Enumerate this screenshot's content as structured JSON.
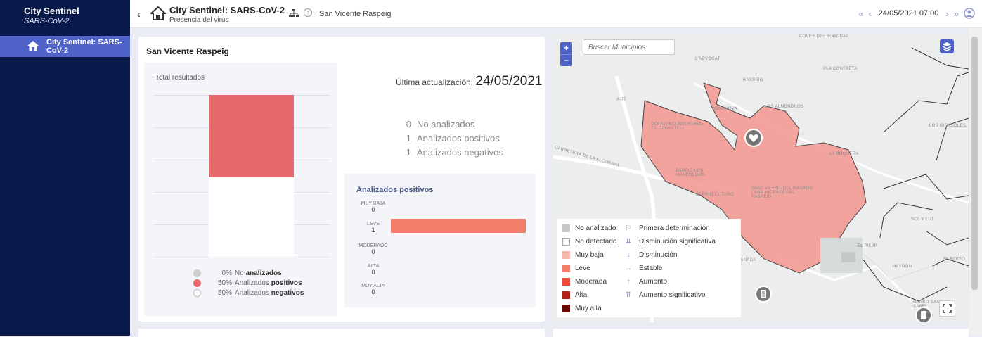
{
  "app": {
    "title": "City Sentinel",
    "subtitle": "SARS-CoV-2"
  },
  "sidebar": {
    "items": [
      {
        "label": "City Sentinel: SARS-CoV-2",
        "icon": "home-icon"
      }
    ]
  },
  "header": {
    "title": "City Sentinel: SARS-CoV-2",
    "subtitle": "Presencia del virus",
    "municipality": "San Vicente Raspeig",
    "datetime": "24/05/2021 07:00",
    "nav": {
      "first": "«",
      "prev": "‹",
      "next": "›",
      "last": "»"
    }
  },
  "panel": {
    "title": "San Vicente Raspeig",
    "total_title": "Total resultados",
    "last_update_label": "Última actualización:",
    "last_update_value": "24/05/2021",
    "stats": [
      {
        "count": "0",
        "label": "No analizados"
      },
      {
        "count": "1",
        "label": "Analizados positivos"
      },
      {
        "count": "1",
        "label": "Analizados negativos"
      }
    ],
    "legend": [
      {
        "pct": "0%",
        "pre": "No",
        "bold": "analizados",
        "color": "#cfcfcf"
      },
      {
        "pct": "50%",
        "pre": "Analizados",
        "bold": "positivos",
        "color": "#e66a6c"
      },
      {
        "pct": "50%",
        "pre": "Analizados",
        "bold": "negativos",
        "color": "#ffffff"
      }
    ]
  },
  "positives": {
    "title": "Analizados positivos",
    "levels": [
      {
        "label": "MUY BAJA",
        "value": "0"
      },
      {
        "label": "LEVE",
        "value": "1"
      },
      {
        "label": "MODERADO",
        "value": "0"
      },
      {
        "label": "ALTA",
        "value": "0"
      },
      {
        "label": "MUY ALTA",
        "value": "0"
      }
    ]
  },
  "chart_data": [
    {
      "type": "bar",
      "title": "Total resultados",
      "categories": [
        "Analizados positivos",
        "Analizados negativos"
      ],
      "values": [
        50,
        50
      ],
      "stacked": true,
      "ylim": [
        0,
        100
      ]
    },
    {
      "type": "bar",
      "title": "Analizados positivos",
      "categories": [
        "MUY BAJA",
        "LEVE",
        "MODERADO",
        "ALTA",
        "MUY ALTA"
      ],
      "values": [
        0,
        1,
        0,
        0,
        0
      ],
      "orientation": "horizontal"
    }
  ],
  "map": {
    "search_placeholder": "Buscar Municipios",
    "zoom_in": "+",
    "zoom_out": "−",
    "labels": [
      "COVES DEL BORONAT",
      "L'ADVOCAT",
      "PLA CONTXETA",
      "RASPEIG",
      "BONANOVA",
      "LOS ALMENDROS",
      "POLÍGONO INDUSTRIAL EL CANASTELL",
      "LOS GIRASOLES",
      "LA BOQUERA",
      "BARRIO LOS MANCHEGOS",
      "BARRIO EL TUBO",
      "SANT VICENT DEL RASPEIG / SAN VICENTE DEL RASPEIG",
      "SOL Y LUZ",
      "EL PILAR",
      "BARRIO GRANADA",
      "HAYGÓN",
      "BARRIO SANTA ISABEL",
      "CARRETERA DE LA ALCORAYA",
      "EL ROCIO",
      "A-77"
    ],
    "legend_levels": [
      {
        "label": "No analizado",
        "color": "#c8c8c8"
      },
      {
        "label": "No detectado",
        "color": "#ffffff"
      },
      {
        "label": "Muy baja",
        "color": "#f7b8b0"
      },
      {
        "label": "Leve",
        "color": "#f47e6c"
      },
      {
        "label": "Moderada",
        "color": "#ef4a3a"
      },
      {
        "label": "Alta",
        "color": "#b32316"
      },
      {
        "label": "Muy alta",
        "color": "#6b0a05"
      }
    ],
    "legend_trends": [
      {
        "label": "Primera determinación",
        "icon": "flag-icon",
        "glyph": "⚐"
      },
      {
        "label": "Disminución significativa",
        "icon": "double-down-arrow-icon",
        "glyph": "⇊"
      },
      {
        "label": "Disminución",
        "icon": "down-arrow-icon",
        "glyph": "↓"
      },
      {
        "label": "Estable",
        "icon": "right-arrow-icon",
        "glyph": "→"
      },
      {
        "label": "Aumento",
        "icon": "up-arrow-icon",
        "glyph": "↑"
      },
      {
        "label": "Aumento significativo",
        "icon": "double-up-arrow-icon",
        "glyph": "⇈"
      }
    ]
  }
}
